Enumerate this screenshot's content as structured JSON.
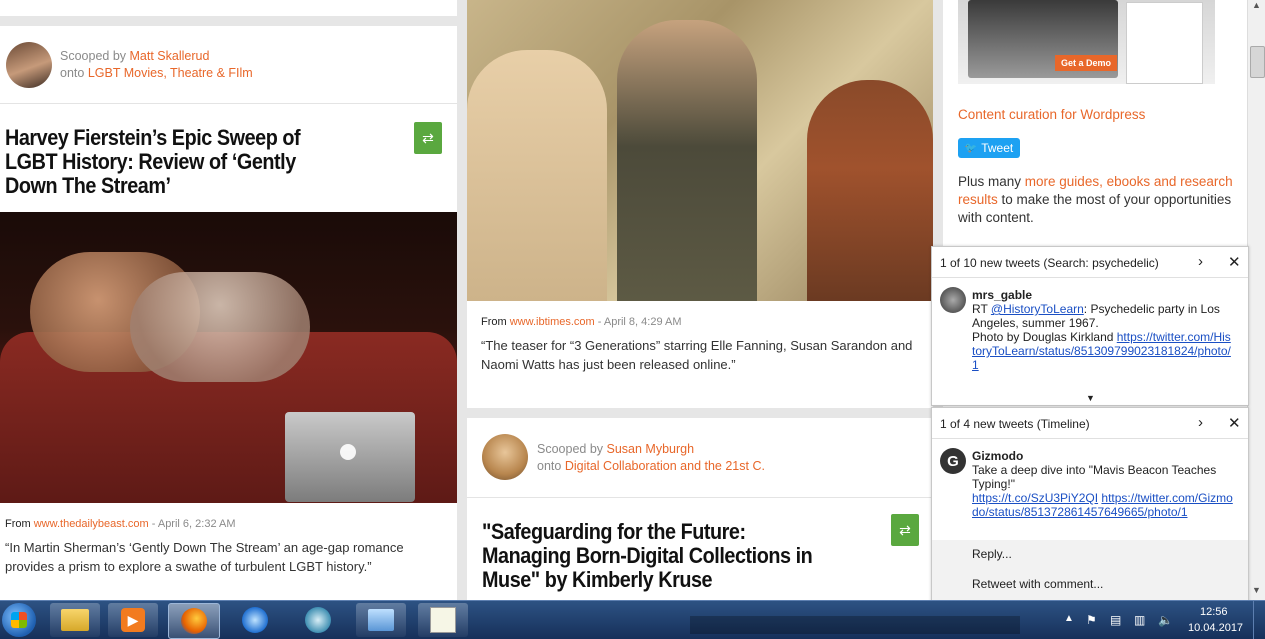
{
  "left_card_top": {},
  "left_post": {
    "scooped_by_prefix": "Scooped by",
    "scooped_by_name": "Matt Skallerud",
    "onto_prefix": "onto",
    "onto_topic": "LGBT Movies, Theatre & FIlm",
    "title": "Harvey Fierstein’s Epic Sweep of LGBT History: Review of ‘Gently Down The Stream’",
    "from_prefix": "From",
    "source": "www.thedailybeast.com",
    "date": " - April 6, 2:32 AM",
    "excerpt": "“In Martin Sherman’s ‘Gently Down The Stream’ an age-gap romance provides a prism to explore a swathe of turbulent LGBT history.”"
  },
  "middle_post": {
    "from_prefix": "From",
    "source": "www.ibtimes.com",
    "date": " - April 8, 4:29 AM",
    "excerpt": "“The teaser for “3 Generations” starring Elle Fanning, Susan Sarandon and Naomi Watts has just been released online.”"
  },
  "middle_post2": {
    "scooped_by_prefix": "Scooped by",
    "scooped_by_name": "Susan Myburgh",
    "onto_prefix": "onto",
    "onto_topic": "Digital Collaboration and the 21st C.",
    "title": "\"Safeguarding for the Future: Managing Born-Digital Collections in Muse\" by Kimberly Kruse"
  },
  "sidebar": {
    "demo_button": "Get a Demo",
    "link": "Content curation for Wordpress",
    "tweet_button": "Tweet",
    "plus_prefix": "Plus many ",
    "plus_link": "more guides, ebooks and research results",
    "plus_suffix": " to make the most of your opportunities with content."
  },
  "notif1": {
    "header": "1 of 10 new tweets (Search: psychedelic)",
    "user": "mrs_gable",
    "rt": "RT ",
    "mention": "@HistoryToLearn",
    "text1": ": Psychedelic party in Los Angeles, summer 1967.",
    "text2": "Photo by Douglas Kirkland ",
    "url": "https://twitter.com/HistoryToLearn/status/851309799023181824/photo/1"
  },
  "notif2": {
    "header": "1 of 4 new tweets (Timeline)",
    "user": "Gizmodo",
    "text": "Take a deep dive into \"Mavis Beacon Teaches Typing!\"",
    "url1": "https://t.co/SzU3PiY2QI",
    "url2": "https://twitter.com/Gizmodo/status/851372861457649665/photo/1",
    "reply": "Reply...",
    "retweet": "Retweet with comment..."
  },
  "taskbar": {
    "time": "12:56",
    "date": "10.04.2017"
  },
  "colors": {
    "accent": "#e8672a",
    "rescoop": "#5aa83f",
    "twitter": "#1da1f2",
    "taskbar": "#1f3d6b"
  }
}
